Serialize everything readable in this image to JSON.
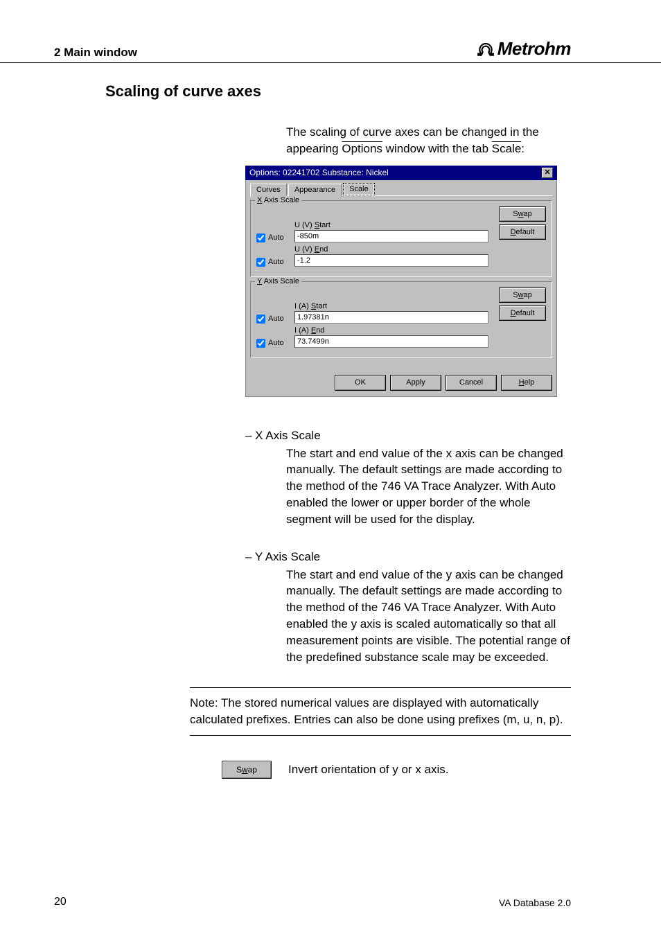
{
  "header": {
    "section": "2  Main window",
    "brand": "Metrohm"
  },
  "title": "Scaling of curve axes",
  "intro": {
    "pre": "The scaling of curve axes can be changed in the appearing ",
    "mid": " window with the tab ",
    "post": ":",
    "options_word": "Options",
    "scale_word": "Scale"
  },
  "dialog": {
    "title": "Options: 02241702 Substance: Nickel",
    "tabs": {
      "curves": "Curves",
      "appearance": "Appearance",
      "scale": "Scale"
    },
    "x_group": {
      "legend_pre": "X",
      "legend_post": " Axis Scale",
      "start_label_pre": "U (V) ",
      "start_label_ul": "S",
      "start_label_post": "tart",
      "start_value": "-850m",
      "end_label_pre": "U (V) ",
      "end_label_ul": "E",
      "end_label_post": "nd",
      "end_value": "-1.2",
      "auto_label": "Auto"
    },
    "y_group": {
      "legend_pre": "Y",
      "legend_post": " Axis Scale",
      "start_label_pre": "I (A) ",
      "start_label_ul": "S",
      "start_label_post": "tart",
      "start_value": "1.97381n",
      "end_label_pre": "I (A) ",
      "end_label_ul": "E",
      "end_label_post": "nd",
      "end_value": "73.7499n",
      "auto_label": "Auto"
    },
    "buttons": {
      "swap_pre": "S",
      "swap_ul": "w",
      "swap_post": "ap",
      "default_ul": "D",
      "default_post": "efault",
      "ok": "OK",
      "apply": "Apply",
      "cancel": "Cancel",
      "help_ul": "H",
      "help_post": "elp"
    }
  },
  "desc": {
    "x_label": "– X Axis Scale",
    "x_text": "The start and end value of the x axis can be changed manually. The default settings are made according to the method of the 746 VA Trace Analyzer. With Auto enabled the lower or upper border of the whole segment will be used for the display.",
    "y_label": "– Y Axis Scale",
    "y_text": "The start and end value of the y axis can be changed manually. The default settings are made according to the method of the 746 VA Trace Analyzer. With Auto enabled the y axis is scaled automatically so that all measurement points are visible. The potential range of the predefined substance scale may be exceeded."
  },
  "note": "Note: The stored numerical values are displayed with automatically calculated prefixes. Entries can also be done using prefixes (m, u, n, p).",
  "swap_desc": "Invert orientation of y or x axis.",
  "page_num": "20",
  "footer": "VA Database 2.0"
}
